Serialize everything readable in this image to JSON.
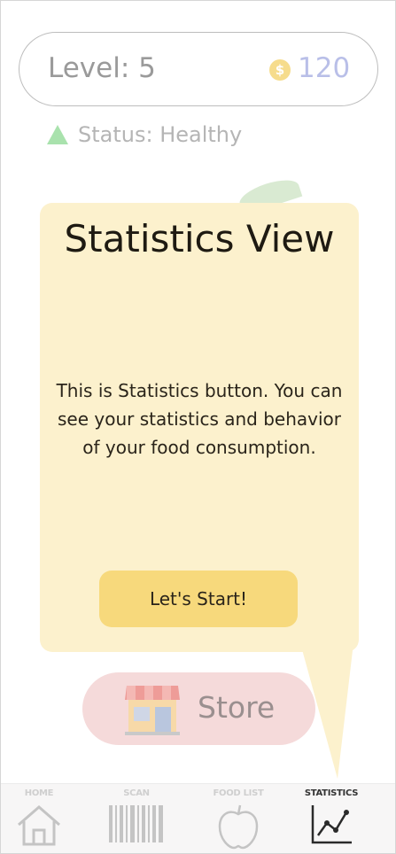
{
  "header": {
    "level_label": "Level: 5",
    "coins_value": "120",
    "coin_symbol": "$",
    "status_label": "Status: Healthy",
    "status_color": "#a9e2ad"
  },
  "tooltip": {
    "title": "Statistics View",
    "body": "This is Statistics button. You can see your statistics and behavior of your food consumption.",
    "button_label": "Let's Start!",
    "bg_color": "#fcf1cd",
    "button_color": "#f7d97c"
  },
  "store": {
    "label": "Store",
    "icon": "store-icon",
    "bg_color": "#f5dada"
  },
  "nav": {
    "items": [
      {
        "label": "HOME",
        "icon": "home-icon",
        "active": false
      },
      {
        "label": "SCAN",
        "icon": "barcode-icon",
        "active": false
      },
      {
        "label": "FOOD LIST",
        "icon": "apple-icon",
        "active": false
      },
      {
        "label": "STATISTICS",
        "icon": "chart-line-icon",
        "active": true
      }
    ]
  }
}
